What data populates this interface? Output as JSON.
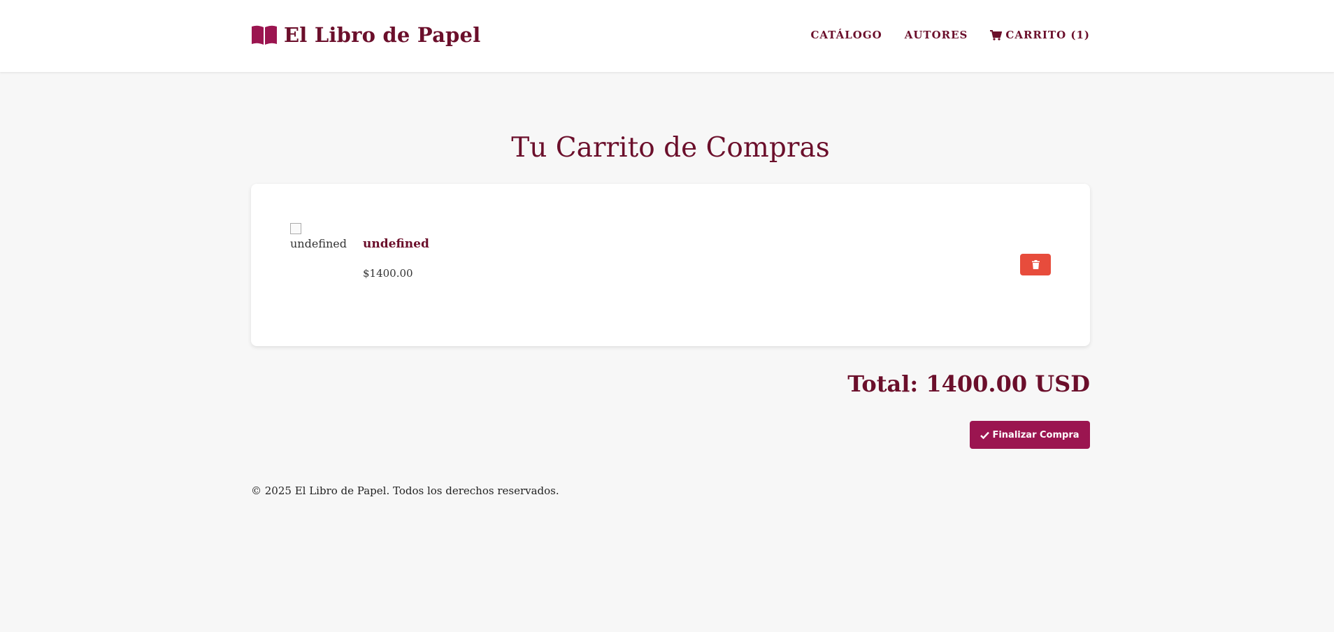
{
  "header": {
    "brand_name": "El Libro de Papel",
    "brand_icon": "book-open-icon",
    "nav": {
      "catalog": "CATÁLOGO",
      "authors": "AUTORES",
      "cart": "CARRITO (1)",
      "cart_icon": "shopping-cart-icon"
    }
  },
  "main": {
    "title": "Tu Carrito de Compras",
    "cart_items": [
      {
        "image_alt": "undefined",
        "title": "undefined",
        "price": "$1400.00",
        "delete_icon": "trash-icon"
      }
    ],
    "total": "Total: 1400.00 USD",
    "checkout_label": "Finalizar Compra",
    "checkout_icon": "check-icon"
  },
  "footer": {
    "text": "© 2025 El Libro de Papel. Todos los derechos reservados."
  },
  "colors": {
    "brand": "#6b0f2b",
    "checkout_button": "#9b1550",
    "delete_button": "#e74c3c",
    "background": "#f7f7f7"
  }
}
